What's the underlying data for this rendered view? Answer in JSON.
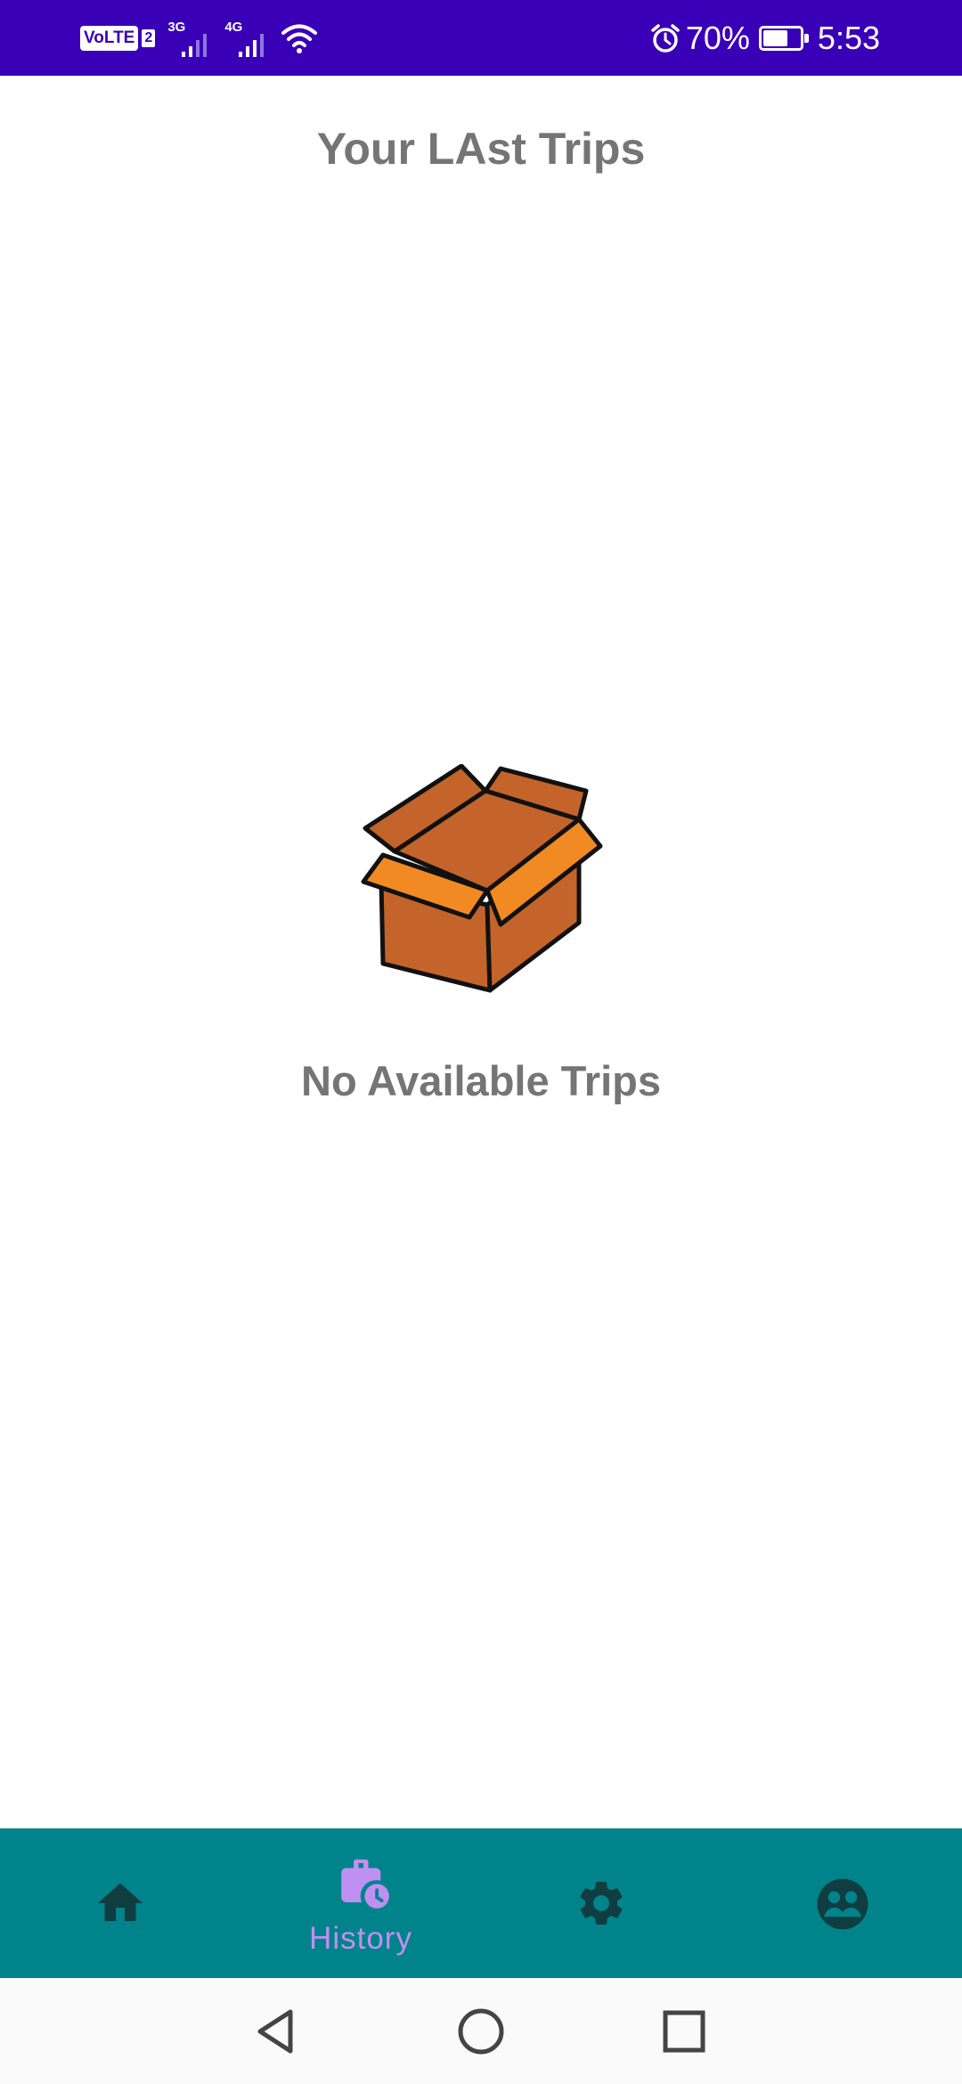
{
  "status_bar": {
    "volte": "VoLTE",
    "sim": "2",
    "network_1": "3G",
    "network_2": "4G",
    "battery_percent": "70%",
    "battery_level": 0.7,
    "time": "5:53",
    "icons": [
      "signal-icon",
      "wifi-icon",
      "alarm-icon",
      "battery-icon"
    ]
  },
  "header": {
    "title": "Your LAst Trips"
  },
  "empty_state": {
    "message": "No Available Trips",
    "illustration": "open-box-icon"
  },
  "bottom_nav": {
    "items": [
      {
        "icon": "home-icon",
        "label": "",
        "active": false
      },
      {
        "icon": "history-icon",
        "label": "History",
        "active": true
      },
      {
        "icon": "gear-icon",
        "label": "",
        "active": false
      },
      {
        "icon": "profile-icon",
        "label": "",
        "active": false
      }
    ]
  },
  "system_nav": {
    "icons": [
      "back-icon",
      "home-circle-icon",
      "recents-icon"
    ]
  },
  "colors": {
    "status_bar": "#3a00b8",
    "bottom_nav": "#00838a",
    "active_accent": "#c08ff2",
    "inactive_icon": "#0f3d40",
    "text_gray": "#757575",
    "box_dark": "#c4642a",
    "box_light": "#f28a24"
  }
}
